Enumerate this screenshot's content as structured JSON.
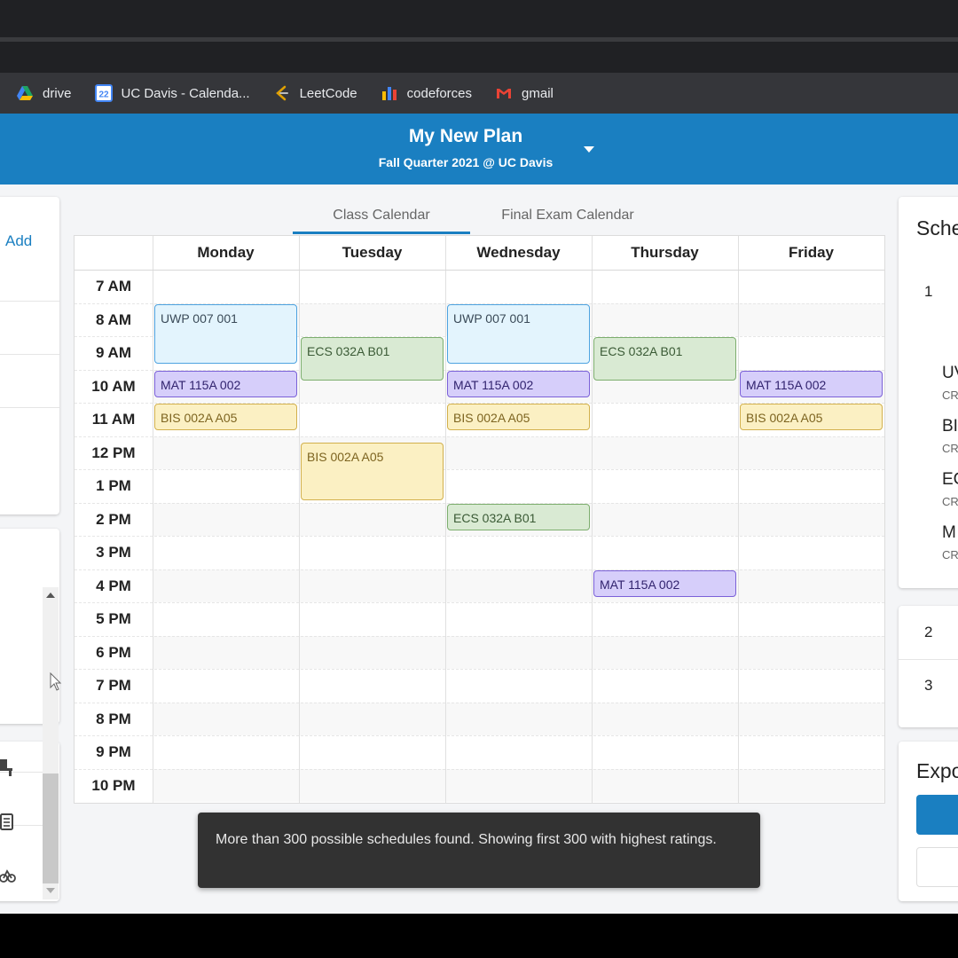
{
  "bookmarks": [
    {
      "label": "drive",
      "icon": "drive-icon"
    },
    {
      "label": "UC Davis - Calenda...",
      "icon": "calendar-icon",
      "badge": "22"
    },
    {
      "label": "LeetCode",
      "icon": "leetcode-icon"
    },
    {
      "label": "codeforces",
      "icon": "codeforces-icon"
    },
    {
      "label": "gmail",
      "icon": "gmail-icon"
    }
  ],
  "header": {
    "title": "My New Plan",
    "subtitle": "Fall Quarter 2021 @ UC Davis"
  },
  "left_panel": {
    "add_label": "Add"
  },
  "tabs": [
    {
      "label": "Class Calendar",
      "active": true
    },
    {
      "label": "Final Exam Calendar",
      "active": false
    }
  ],
  "calendar": {
    "days": [
      "Monday",
      "Tuesday",
      "Wednesday",
      "Thursday",
      "Friday"
    ],
    "times": [
      "7 AM",
      "8 AM",
      "9 AM",
      "10 AM",
      "11 AM",
      "12 PM",
      "1 PM",
      "2 PM",
      "3 PM",
      "4 PM",
      "5 PM",
      "6 PM",
      "7 PM",
      "8 PM",
      "9 PM",
      "10 PM"
    ],
    "events": [
      {
        "label": "UWP 007 001",
        "day": 0,
        "start": 8.0,
        "end": 9.8,
        "kind": "uwp"
      },
      {
        "label": "MAT 115A 002",
        "day": 0,
        "start": 10.0,
        "end": 10.8,
        "kind": "mat"
      },
      {
        "label": "BIS 002A A05",
        "day": 0,
        "start": 11.0,
        "end": 11.8,
        "kind": "bis"
      },
      {
        "label": "ECS 032A B01",
        "day": 1,
        "start": 9.0,
        "end": 10.3,
        "kind": "ecs"
      },
      {
        "label": "BIS 002A A05",
        "day": 1,
        "start": 12.17,
        "end": 13.9,
        "kind": "bis"
      },
      {
        "label": "UWP 007 001",
        "day": 2,
        "start": 8.0,
        "end": 9.8,
        "kind": "uwp"
      },
      {
        "label": "MAT 115A 002",
        "day": 2,
        "start": 10.0,
        "end": 10.8,
        "kind": "mat"
      },
      {
        "label": "BIS 002A A05",
        "day": 2,
        "start": 11.0,
        "end": 11.8,
        "kind": "bis"
      },
      {
        "label": "ECS 032A B01",
        "day": 2,
        "start": 14.0,
        "end": 14.8,
        "kind": "ecs"
      },
      {
        "label": "ECS 032A B01",
        "day": 3,
        "start": 9.0,
        "end": 10.3,
        "kind": "ecs"
      },
      {
        "label": "MAT 115A 002",
        "day": 3,
        "start": 16.0,
        "end": 16.8,
        "kind": "mat"
      },
      {
        "label": "MAT 115A 002",
        "day": 4,
        "start": 10.0,
        "end": 10.8,
        "kind": "mat"
      },
      {
        "label": "BIS 002A A05",
        "day": 4,
        "start": 11.0,
        "end": 11.8,
        "kind": "bis"
      }
    ]
  },
  "toast": {
    "message": "More than 300 possible schedules found. Showing first 300 with highest ratings."
  },
  "right_panel": {
    "schedules_title": "Sche",
    "schedule_numbers": [
      "1",
      "2",
      "3"
    ],
    "course_items": [
      {
        "name": "UV",
        "sub": "CR"
      },
      {
        "name": "BI",
        "sub": "CR"
      },
      {
        "name": "EC",
        "sub": "CR"
      },
      {
        "name": "M",
        "sub": "CR"
      }
    ],
    "export_title": "Expo"
  },
  "colors": {
    "brand": "#1a7fc1",
    "uwp": "#e3f4fd",
    "ecs": "#d9ead3",
    "mat": "#d6cefa",
    "bis": "#fbf0c3"
  }
}
